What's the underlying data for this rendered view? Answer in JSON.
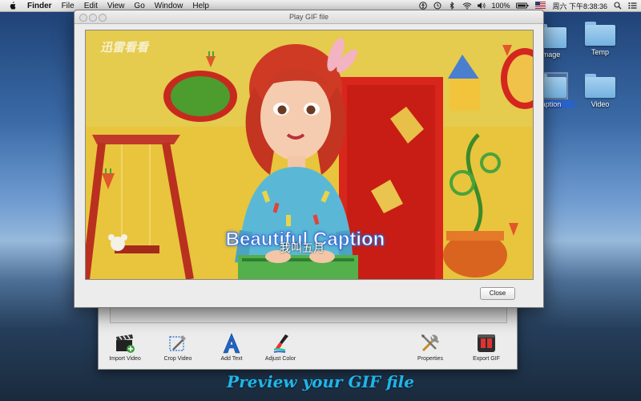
{
  "menubar": {
    "app": "Finder",
    "items": [
      "File",
      "Edit",
      "View",
      "Go",
      "Window",
      "Help"
    ],
    "battery": "100%",
    "clock": "周六 下午8:38:36"
  },
  "desktop": {
    "folders": [
      {
        "label": "mage"
      },
      {
        "label": "Temp"
      },
      {
        "label": "aption"
      },
      {
        "label": "Video"
      }
    ]
  },
  "dialog": {
    "title": "Play GIF file",
    "close_label": "Close",
    "preview": {
      "watermark": "迅雷看看",
      "caption_text": "Beautiful Caption",
      "caption_overlay": "我叫五月"
    }
  },
  "app_toolbar": {
    "import_video": "Import Video",
    "crop_video": "Crop Video",
    "add_text": "Add Text",
    "adjust_color": "Adjust Color",
    "properties": "Properties",
    "export_gif": "Export GIF"
  },
  "banner": {
    "text": "Preview your GIF file"
  },
  "colors": {
    "banner": "#1fb6e8",
    "selection": "#2a62c8",
    "folder": "#8cc0e6"
  }
}
